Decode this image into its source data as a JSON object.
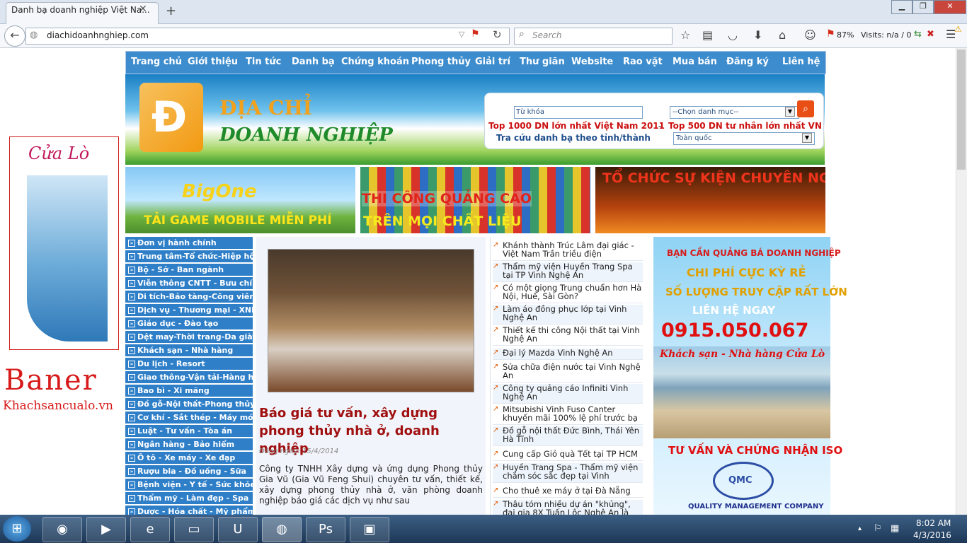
{
  "browser": {
    "tab_title": "Danh bạ doanh nghiệp Việt Na...",
    "url": "diachidoanhnghiep.com",
    "search_placeholder": "Search",
    "zoom": "87%",
    "visits": "Visits: n/a / 0"
  },
  "site_menu": [
    "Trang chủ",
    "Giới thiệu",
    "Tin tức",
    "Danh bạ",
    "Chứng khoán",
    "Phong thủy",
    "Giải trí",
    "Thư giãn",
    "Website",
    "Rao vặt",
    "Mua bán",
    "Đăng ký",
    "Liên hệ"
  ],
  "header": {
    "logo_line1": "ĐỊA CHỈ",
    "logo_line2": "DOANH NGHIỆP",
    "keyword_placeholder": "Từ khóa",
    "category_select": "--Chọn danh mục--",
    "top1000": "Top 1000 DN lớn nhất Việt Nam 2011",
    "dash": "-",
    "top500": "Top 500 DN tư nhân lớn nhất VN",
    "lookup": "Tra cứu danh bạ theo tỉnh/thành",
    "province_select": "Toàn quốc"
  },
  "banners": {
    "b1_logo": "BigOne",
    "b1_text": "TẢI GAME MOBILE MIỄN PHÍ",
    "b2_line1": "THI CÔNG QUẢNG CÁO",
    "b2_line2": "TRÊN MỌI CHẤT LIỆU",
    "b3_text": "TỔ CHỨC SỰ KIỆN CHUYÊN NGHIỆP"
  },
  "left_ad": {
    "title": "Cửa Lò",
    "baner": "Baner",
    "site": "Khachsancualo.vn"
  },
  "categories": [
    "Đơn vị hành chính",
    "Trung tâm-Tổ chức-Hiệp hội",
    "Bộ - Sở - Ban ngành",
    "Viễn thông CNTT - Bưu chính",
    "Di tích-Bảo tàng-Công viên",
    "Dịch vụ - Thương mại - XNK",
    "Giáo dục - Đào tạo",
    "Dệt may-Thời trang-Da giày",
    "Khách sạn - Nhà hàng",
    "Du lịch - Resort",
    "Giao thông-Vận tải-Hàng hải",
    "Bao bì - Xi măng",
    "Đồ gỗ-Nội thất-Phong thủy",
    "Cơ khí - Sắt thép - Máy móc",
    "Luật - Tư vấn - Tòa án",
    "Ngân hàng - Bảo hiểm",
    "Ô tô - Xe máy - Xe đạp",
    "Rượu bia - Đồ uống - Sữa",
    "Bệnh viện - Y tế - Sức khỏe",
    "Thẩm mỹ - Làm đẹp - Spa",
    "Dược - Hóa chất - Mỹ phẩm"
  ],
  "article": {
    "title": "Báo giá tư vấn, xây dựng phong thủy nhà ở, doanh nghiệp",
    "date": "Đăng ngày: 15/4/2014",
    "body": "Công ty TNHH Xây dựng và ứng dụng Phong thủy Gia Vũ (Gia Vũ Feng Shui) chuyên tư vấn, thiết kế, xây dựng phong thủy nhà ở, văn phòng doanh nghiệp báo giá các dịch vụ như sau"
  },
  "news": [
    "Khánh thành Trúc Lâm đại giác - Việt Nam Trần triều điện",
    "Thẩm mỹ viện Huyền Trang Spa tại TP Vinh Nghệ An",
    "Có một giọng Trung chuẩn hơn Hà Nội, Huế, Sài Gòn?",
    "Làm áo đồng phục lớp tại Vinh Nghệ An",
    "Thiết kế thi công Nội thất tại Vinh Nghệ An",
    "Đại lý Mazda Vinh Nghệ An",
    "Sửa chữa điện nước tại Vinh Nghệ An",
    "Công ty quảng cáo Infiniti Vinh Nghệ An",
    "Mitsubishi Vinh Fuso Canter khuyến mãi 100% lệ phí trước bạ",
    "Đồ gỗ nội thất Đức Bình, Thái Yên Hà Tĩnh",
    "Cung cấp Giỏ quà Tết tại TP HCM",
    "Huyền Trang Spa - Thẩm mỹ viện chăm sóc sắc đẹp tại Vinh",
    "Cho thuê xe máy ở tại Đà Nẵng",
    "Thâu tóm nhiều dự án \"khủng\", đại gia 8X Tuấn Lộc Nghệ An là"
  ],
  "right_ad": {
    "line1": "BẠN CẦN QUẢNG BÁ DOANH NGHIỆP",
    "line2": "CHI PHÍ CỰC KỲ RẺ",
    "line3": "SỐ LƯỢNG TRUY CẬP RẤT LỚN",
    "line4": "LIÊN HỆ NGAY",
    "phone": "0915.050.067",
    "hotel": "Khách sạn - Nhà hàng Cửa Lò",
    "iso": "TƯ VẤN VÀ CHỨNG NHẬN ISO",
    "qmc": "QMC",
    "qmc_sub": "QUALITY MANAGEMENT COMPANY"
  },
  "taskbar": {
    "time": "8:02 AM",
    "date": "4/3/2016"
  }
}
